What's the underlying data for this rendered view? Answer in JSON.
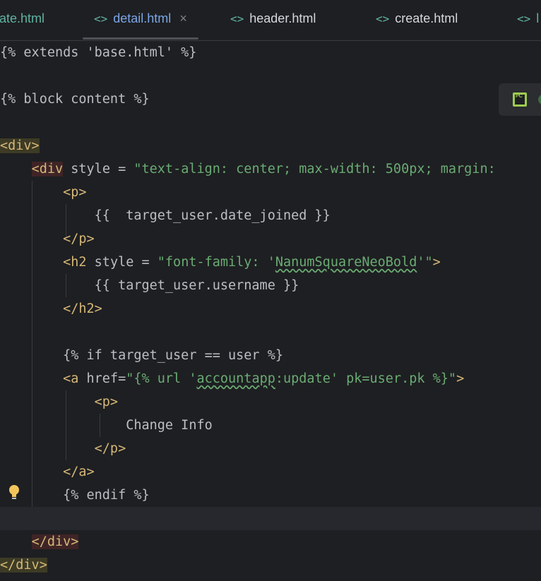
{
  "tabs": [
    {
      "label": "ate.html",
      "icon": "html-tag-icon",
      "partial": true,
      "active": false
    },
    {
      "label": "detail.html",
      "icon": "html-tag-icon",
      "active": true,
      "close": "×"
    },
    {
      "label": "header.html",
      "icon": "html-tag-icon",
      "active": false
    },
    {
      "label": "create.html",
      "icon": "html-tag-icon",
      "active": false
    },
    {
      "label": "l",
      "icon": "html-tag-icon",
      "partial": true,
      "active": false
    }
  ],
  "tab_icon_glyph": "<>",
  "widget": {
    "icon": "pycharm-icon",
    "text": "PC"
  },
  "code": {
    "l1": "{% extends 'base.html' %}",
    "l3": "{% block content %}",
    "l5_tag": "<div>",
    "l6_tag": "<div",
    "l6_attr": " style ",
    "l6_eq": "= ",
    "l6_str": "\"text-align: center; max-width: 500px; margin:",
    "l7_tag": "<p>",
    "l8_text": "{{  target_user.date_joined }}",
    "l9_tag": "</p>",
    "l10_tag": "<h2",
    "l10_attr": " style ",
    "l10_eq": "= ",
    "l10_str_a": "\"font-family: '",
    "l10_str_b": "NanumSquareNeoBold",
    "l10_str_c": "'\"",
    "l10_close": ">",
    "l11_text": "{{ target_user.username }}",
    "l12_tag": "</h2>",
    "l14_text": "{% if target_user == user %}",
    "l15_tag": "<a",
    "l15_attr": " href",
    "l15_eq": "=",
    "l15_str_a": "\"{% url '",
    "l15_str_b": "accountapp",
    "l15_str_c": ":update' pk=user.pk %}\"",
    "l15_close": ">",
    "l16_tag": "<p>",
    "l17_text": "Change Info",
    "l18_tag": "</p>",
    "l19_tag": "</a>",
    "l20_text": "{% endif %}",
    "l22_tag": "</div>",
    "l23_tag": "</div>"
  },
  "colors": {
    "background": "#1e1f22",
    "tag": "#d5b778",
    "string": "#6aab73",
    "text": "#bcbec4",
    "active_tab": "#7aa6e6"
  }
}
